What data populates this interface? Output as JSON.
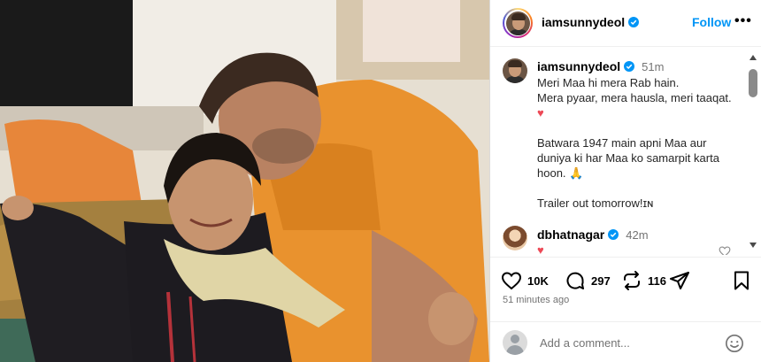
{
  "post": {
    "username": "iamsunnydeol",
    "follow_label": "Follow",
    "more_label": "•••"
  },
  "caption": {
    "username": "iamsunnydeol",
    "time": "51m",
    "line1": "Meri Maa hi mera Rab hain.",
    "line2": "Mera pyaar, mera hausla, meri taaqat.",
    "heart": "♥",
    "line3": "Batwara 1947 main apni Maa aur",
    "line4": "duniya ki har Maa ko samarpit karta",
    "line5": "hoon. 🙏",
    "line6": "Trailer out tomorrow!ɪɴ"
  },
  "reply": {
    "username": "dbhatnagar",
    "time": "42m",
    "text": "♥ ♥"
  },
  "actions": {
    "likes": "10K",
    "comments": "297",
    "reposts": "116"
  },
  "timestamp": "51 minutes ago",
  "comment_box": {
    "placeholder": "Add a comment..."
  },
  "colors": {
    "accent": "#0095f6",
    "verified": "#0095f6",
    "heart": "#ed4956"
  }
}
